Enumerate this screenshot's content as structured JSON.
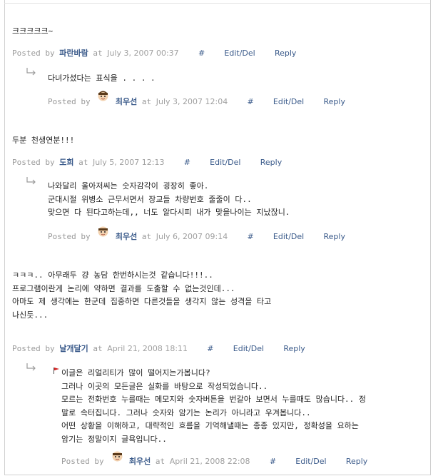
{
  "labels": {
    "posted_by": "Posted by",
    "at": "at",
    "hash": "#",
    "edit": "Edit/Del",
    "reply": "Reply"
  },
  "comments": [
    {
      "text": [
        "크크크크크~"
      ],
      "author": "파란바람",
      "date": "July 3, 2007 00:37",
      "reply": {
        "text": [
          "다녀가셨다는 표식을 . . . ."
        ],
        "author": "최우선",
        "date": "July 3, 2007 12:04"
      }
    },
    {
      "text": [
        "두분 천생연분!!!"
      ],
      "author": "도희",
      "date": "July 5, 2007 12:13",
      "reply": {
        "text": [
          "나와달리 울아저씨는 숫자감각이 굉장히 좋아.",
          "군대시절 위병소 근무서면서 장교들 차량번호 줄줄이 다..",
          "맞으면 다 된다고하는데,, 너도 알다시피 내가 맞을나이는 지났잖니."
        ],
        "author": "최우선",
        "date": "July 6, 2007 09:14"
      }
    },
    {
      "text": [
        "ㅋㅋㅋ.. 아무래두 걍 농담 한번하시는것 같습니다!!!..",
        "프로그램이란게 논리에 약하면 결과를 도출할 수 없는것인데...",
        "아마도 제 생각에는 한군데 집중하면 다른것들을 생각지 않는 성격을 타고",
        "나신듯..."
      ],
      "author": "날개달기",
      "date": "April 21, 2008 18:11",
      "reply": {
        "text": [
          "이글은 리얼리티가 많이 떨어지는가봅니다?",
          "그러나 이곳의 모든글은 실화를 바탕으로 작성되었습니다..",
          "모르는 전화번호 누를때는 메모지와 숫자버튼을 번갈아 보면서 누를때도 많습니다.. 정",
          "말로 속터집니다. 그러나 숫자와 암기는 논리가 아니라고 우겨봅니다..",
          "어떤 상황을 이해하고, 대략적인 흐름을 기억해낼때는 종종 있지만, 정확성을 요하는",
          "암기는 정말이지 글욕입니다.."
        ],
        "author": "최우선",
        "date": "April 21, 2008 22:08"
      }
    }
  ]
}
